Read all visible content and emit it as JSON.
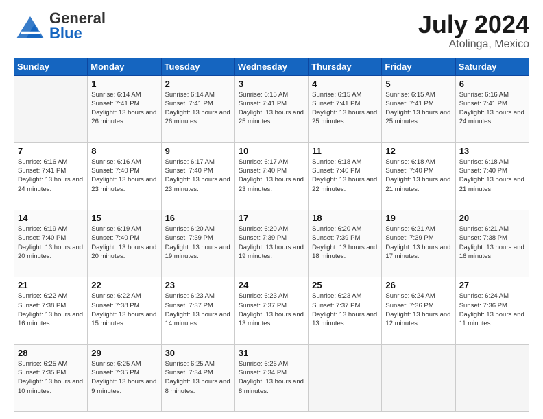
{
  "header": {
    "logo_general": "General",
    "logo_blue": "Blue",
    "month_year": "July 2024",
    "location": "Atolinga, Mexico"
  },
  "days_of_week": [
    "Sunday",
    "Monday",
    "Tuesday",
    "Wednesday",
    "Thursday",
    "Friday",
    "Saturday"
  ],
  "weeks": [
    [
      {
        "day": "",
        "sunrise": "",
        "sunset": "",
        "daylight": ""
      },
      {
        "day": "1",
        "sunrise": "Sunrise: 6:14 AM",
        "sunset": "Sunset: 7:41 PM",
        "daylight": "Daylight: 13 hours and 26 minutes."
      },
      {
        "day": "2",
        "sunrise": "Sunrise: 6:14 AM",
        "sunset": "Sunset: 7:41 PM",
        "daylight": "Daylight: 13 hours and 26 minutes."
      },
      {
        "day": "3",
        "sunrise": "Sunrise: 6:15 AM",
        "sunset": "Sunset: 7:41 PM",
        "daylight": "Daylight: 13 hours and 25 minutes."
      },
      {
        "day": "4",
        "sunrise": "Sunrise: 6:15 AM",
        "sunset": "Sunset: 7:41 PM",
        "daylight": "Daylight: 13 hours and 25 minutes."
      },
      {
        "day": "5",
        "sunrise": "Sunrise: 6:15 AM",
        "sunset": "Sunset: 7:41 PM",
        "daylight": "Daylight: 13 hours and 25 minutes."
      },
      {
        "day": "6",
        "sunrise": "Sunrise: 6:16 AM",
        "sunset": "Sunset: 7:41 PM",
        "daylight": "Daylight: 13 hours and 24 minutes."
      }
    ],
    [
      {
        "day": "7",
        "sunrise": "Sunrise: 6:16 AM",
        "sunset": "Sunset: 7:41 PM",
        "daylight": "Daylight: 13 hours and 24 minutes."
      },
      {
        "day": "8",
        "sunrise": "Sunrise: 6:16 AM",
        "sunset": "Sunset: 7:40 PM",
        "daylight": "Daylight: 13 hours and 23 minutes."
      },
      {
        "day": "9",
        "sunrise": "Sunrise: 6:17 AM",
        "sunset": "Sunset: 7:40 PM",
        "daylight": "Daylight: 13 hours and 23 minutes."
      },
      {
        "day": "10",
        "sunrise": "Sunrise: 6:17 AM",
        "sunset": "Sunset: 7:40 PM",
        "daylight": "Daylight: 13 hours and 23 minutes."
      },
      {
        "day": "11",
        "sunrise": "Sunrise: 6:18 AM",
        "sunset": "Sunset: 7:40 PM",
        "daylight": "Daylight: 13 hours and 22 minutes."
      },
      {
        "day": "12",
        "sunrise": "Sunrise: 6:18 AM",
        "sunset": "Sunset: 7:40 PM",
        "daylight": "Daylight: 13 hours and 21 minutes."
      },
      {
        "day": "13",
        "sunrise": "Sunrise: 6:18 AM",
        "sunset": "Sunset: 7:40 PM",
        "daylight": "Daylight: 13 hours and 21 minutes."
      }
    ],
    [
      {
        "day": "14",
        "sunrise": "Sunrise: 6:19 AM",
        "sunset": "Sunset: 7:40 PM",
        "daylight": "Daylight: 13 hours and 20 minutes."
      },
      {
        "day": "15",
        "sunrise": "Sunrise: 6:19 AM",
        "sunset": "Sunset: 7:40 PM",
        "daylight": "Daylight: 13 hours and 20 minutes."
      },
      {
        "day": "16",
        "sunrise": "Sunrise: 6:20 AM",
        "sunset": "Sunset: 7:39 PM",
        "daylight": "Daylight: 13 hours and 19 minutes."
      },
      {
        "day": "17",
        "sunrise": "Sunrise: 6:20 AM",
        "sunset": "Sunset: 7:39 PM",
        "daylight": "Daylight: 13 hours and 19 minutes."
      },
      {
        "day": "18",
        "sunrise": "Sunrise: 6:20 AM",
        "sunset": "Sunset: 7:39 PM",
        "daylight": "Daylight: 13 hours and 18 minutes."
      },
      {
        "day": "19",
        "sunrise": "Sunrise: 6:21 AM",
        "sunset": "Sunset: 7:39 PM",
        "daylight": "Daylight: 13 hours and 17 minutes."
      },
      {
        "day": "20",
        "sunrise": "Sunrise: 6:21 AM",
        "sunset": "Sunset: 7:38 PM",
        "daylight": "Daylight: 13 hours and 16 minutes."
      }
    ],
    [
      {
        "day": "21",
        "sunrise": "Sunrise: 6:22 AM",
        "sunset": "Sunset: 7:38 PM",
        "daylight": "Daylight: 13 hours and 16 minutes."
      },
      {
        "day": "22",
        "sunrise": "Sunrise: 6:22 AM",
        "sunset": "Sunset: 7:38 PM",
        "daylight": "Daylight: 13 hours and 15 minutes."
      },
      {
        "day": "23",
        "sunrise": "Sunrise: 6:23 AM",
        "sunset": "Sunset: 7:37 PM",
        "daylight": "Daylight: 13 hours and 14 minutes."
      },
      {
        "day": "24",
        "sunrise": "Sunrise: 6:23 AM",
        "sunset": "Sunset: 7:37 PM",
        "daylight": "Daylight: 13 hours and 13 minutes."
      },
      {
        "day": "25",
        "sunrise": "Sunrise: 6:23 AM",
        "sunset": "Sunset: 7:37 PM",
        "daylight": "Daylight: 13 hours and 13 minutes."
      },
      {
        "day": "26",
        "sunrise": "Sunrise: 6:24 AM",
        "sunset": "Sunset: 7:36 PM",
        "daylight": "Daylight: 13 hours and 12 minutes."
      },
      {
        "day": "27",
        "sunrise": "Sunrise: 6:24 AM",
        "sunset": "Sunset: 7:36 PM",
        "daylight": "Daylight: 13 hours and 11 minutes."
      }
    ],
    [
      {
        "day": "28",
        "sunrise": "Sunrise: 6:25 AM",
        "sunset": "Sunset: 7:35 PM",
        "daylight": "Daylight: 13 hours and 10 minutes."
      },
      {
        "day": "29",
        "sunrise": "Sunrise: 6:25 AM",
        "sunset": "Sunset: 7:35 PM",
        "daylight": "Daylight: 13 hours and 9 minutes."
      },
      {
        "day": "30",
        "sunrise": "Sunrise: 6:25 AM",
        "sunset": "Sunset: 7:34 PM",
        "daylight": "Daylight: 13 hours and 8 minutes."
      },
      {
        "day": "31",
        "sunrise": "Sunrise: 6:26 AM",
        "sunset": "Sunset: 7:34 PM",
        "daylight": "Daylight: 13 hours and 8 minutes."
      },
      {
        "day": "",
        "sunrise": "",
        "sunset": "",
        "daylight": ""
      },
      {
        "day": "",
        "sunrise": "",
        "sunset": "",
        "daylight": ""
      },
      {
        "day": "",
        "sunrise": "",
        "sunset": "",
        "daylight": ""
      }
    ]
  ]
}
